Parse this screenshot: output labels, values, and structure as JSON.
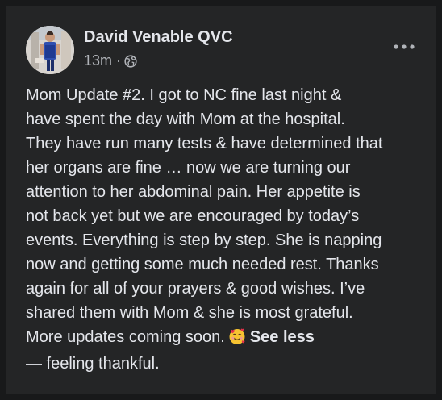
{
  "post": {
    "author": "David Venable QVC",
    "time": "13m",
    "separator": "·",
    "audience_icon": "globe-icon",
    "more_icon": "more-options-icon",
    "lines": [
      "Mom Update #2. I got to NC fine last night &",
      "have spent the day with Mom at the hospital.",
      "They have run many tests & have determined that",
      "her organs are fine … now we are turning our",
      "attention to her abdominal pain. Her appetite is",
      "not back yet but we are encouraged by today’s",
      "events. Everything is step by step. She is napping",
      "now and getting some much needed rest. Thanks",
      "again for all of your prayers & good wishes. I’ve",
      "shared them with Mom & she is most grateful.",
      "More updates coming soon."
    ],
    "emoji_icon": "smiling-face-with-hearts-icon",
    "see_less": "See less",
    "feeling": "— feeling thankful."
  },
  "colors": {
    "background": "#18191a",
    "card": "#242526",
    "primary_text": "#e4e6eb",
    "secondary_text": "#b0b3b8"
  }
}
